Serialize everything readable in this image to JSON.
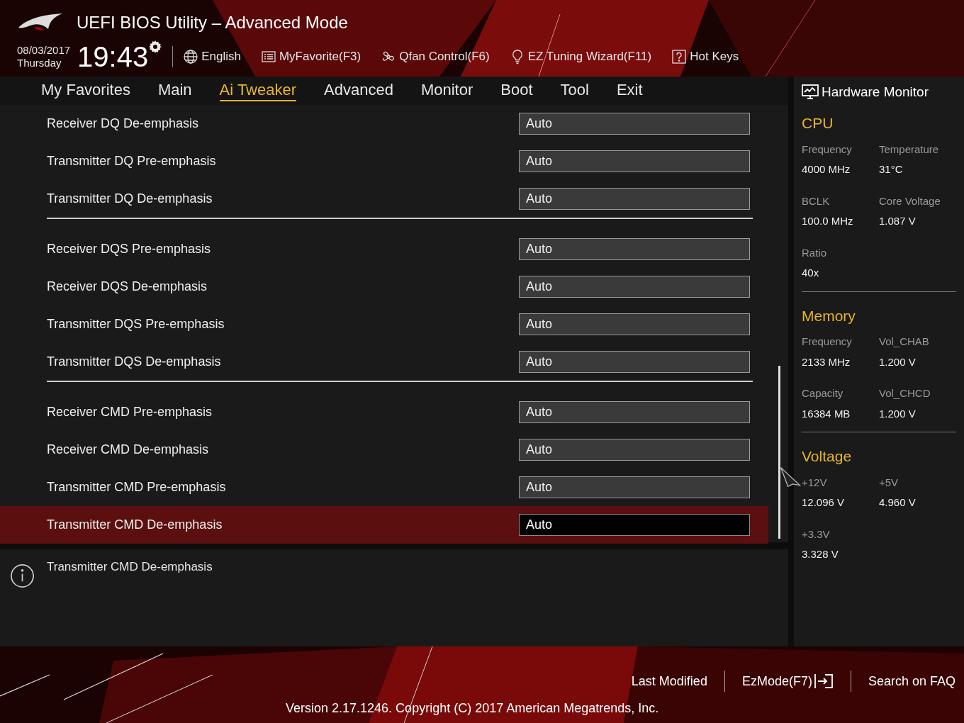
{
  "header": {
    "title": "UEFI BIOS Utility – Advanced Mode",
    "date": "08/03/2017",
    "day": "Thursday",
    "time": "19:43",
    "tools": [
      {
        "kind": "globe",
        "label": "English"
      },
      {
        "kind": "list",
        "label": "MyFavorite(F3)"
      },
      {
        "kind": "fan",
        "label": "Qfan Control(F6)"
      },
      {
        "kind": "bulb",
        "label": "EZ Tuning Wizard(F11)"
      },
      {
        "kind": "help",
        "label": "Hot Keys"
      }
    ]
  },
  "tabs": [
    {
      "label": "My Favorites",
      "selected": false
    },
    {
      "label": "Main",
      "selected": false
    },
    {
      "label": "Ai Tweaker",
      "selected": true
    },
    {
      "label": "Advanced",
      "selected": false
    },
    {
      "label": "Monitor",
      "selected": false
    },
    {
      "label": "Boot",
      "selected": false
    },
    {
      "label": "Tool",
      "selected": false
    },
    {
      "label": "Exit",
      "selected": false
    }
  ],
  "settings": [
    [
      {
        "label": "Receiver DQ De-emphasis",
        "value": "Auto",
        "selected": false
      },
      {
        "label": "Transmitter DQ Pre-emphasis",
        "value": "Auto",
        "selected": false
      },
      {
        "label": "Transmitter DQ De-emphasis",
        "value": "Auto",
        "selected": false
      }
    ],
    [
      {
        "label": "Receiver DQS Pre-emphasis",
        "value": "Auto",
        "selected": false
      },
      {
        "label": "Receiver DQS De-emphasis",
        "value": "Auto",
        "selected": false
      },
      {
        "label": "Transmitter DQS Pre-emphasis",
        "value": "Auto",
        "selected": false
      },
      {
        "label": "Transmitter DQS De-emphasis",
        "value": "Auto",
        "selected": false
      }
    ],
    [
      {
        "label": "Receiver CMD Pre-emphasis",
        "value": "Auto",
        "selected": false
      },
      {
        "label": "Receiver CMD De-emphasis",
        "value": "Auto",
        "selected": false
      },
      {
        "label": "Transmitter CMD Pre-emphasis",
        "value": "Auto",
        "selected": false
      },
      {
        "label": "Transmitter CMD De-emphasis",
        "value": "Auto",
        "selected": true
      }
    ]
  ],
  "help_text": "Transmitter CMD De-emphasis",
  "hardware_monitor": {
    "title": "Hardware Monitor",
    "sections": [
      {
        "title": "CPU",
        "items": [
          {
            "label": "Frequency",
            "value": "4000 MHz"
          },
          {
            "label": "Temperature",
            "value": "31°C"
          },
          {
            "label": "BCLK",
            "value": "100.0 MHz"
          },
          {
            "label": "Core Voltage",
            "value": "1.087 V"
          },
          {
            "label": "Ratio",
            "value": "40x"
          }
        ]
      },
      {
        "title": "Memory",
        "items": [
          {
            "label": "Frequency",
            "value": "2133 MHz"
          },
          {
            "label": "Vol_CHAB",
            "value": "1.200 V"
          },
          {
            "label": "Capacity",
            "value": "16384 MB"
          },
          {
            "label": "Vol_CHCD",
            "value": "1.200 V"
          }
        ]
      },
      {
        "title": "Voltage",
        "items": [
          {
            "label": "+12V",
            "value": "12.096 V"
          },
          {
            "label": "+5V",
            "value": "4.960 V"
          },
          {
            "label": "+3.3V",
            "value": "3.328 V"
          }
        ]
      }
    ]
  },
  "footer": {
    "links": [
      "Last Modified",
      "EzMode(F7)",
      "Search on FAQ"
    ],
    "version": "Version 2.17.1246. Copyright (C) 2017 American Megatrends, Inc."
  }
}
